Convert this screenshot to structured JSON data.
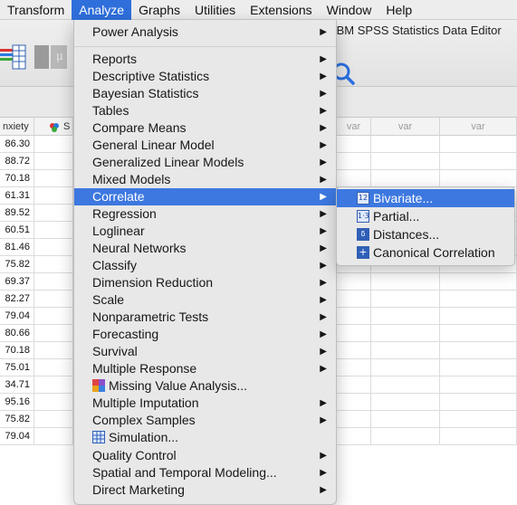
{
  "menubar": {
    "items": [
      {
        "label": "Transform"
      },
      {
        "label": "Analyze"
      },
      {
        "label": "Graphs"
      },
      {
        "label": "Utilities"
      },
      {
        "label": "Extensions"
      },
      {
        "label": "Window"
      },
      {
        "label": "Help"
      }
    ],
    "active": "Analyze"
  },
  "window": {
    "title": "IBM SPSS Statistics Data Editor"
  },
  "grid": {
    "headers": {
      "col1": "nxiety",
      "col2": "S",
      "var_label": "var"
    },
    "values": [
      "86.30",
      "88.72",
      "70.18",
      "61.31",
      "89.52",
      "60.51",
      "81.46",
      "75.82",
      "69.37",
      "82.27",
      "79.04",
      "80.66",
      "70.18",
      "75.01",
      "34.71",
      "95.16",
      "75.82",
      "79.04"
    ]
  },
  "analyze_menu": {
    "items": [
      {
        "label": "Power Analysis",
        "submenu": true
      },
      {
        "label": "Reports",
        "submenu": true
      },
      {
        "label": "Descriptive Statistics",
        "submenu": true
      },
      {
        "label": "Bayesian Statistics",
        "submenu": true
      },
      {
        "label": "Tables",
        "submenu": true
      },
      {
        "label": "Compare Means",
        "submenu": true
      },
      {
        "label": "General Linear Model",
        "submenu": true
      },
      {
        "label": "Generalized Linear Models",
        "submenu": true
      },
      {
        "label": "Mixed Models",
        "submenu": true
      },
      {
        "label": "Correlate",
        "submenu": true,
        "highlighted": true
      },
      {
        "label": "Regression",
        "submenu": true
      },
      {
        "label": "Loglinear",
        "submenu": true
      },
      {
        "label": "Neural Networks",
        "submenu": true
      },
      {
        "label": "Classify",
        "submenu": true
      },
      {
        "label": "Dimension Reduction",
        "submenu": true
      },
      {
        "label": "Scale",
        "submenu": true
      },
      {
        "label": "Nonparametric Tests",
        "submenu": true
      },
      {
        "label": "Forecasting",
        "submenu": true
      },
      {
        "label": "Survival",
        "submenu": true
      },
      {
        "label": "Multiple Response",
        "submenu": true
      },
      {
        "label": "Missing Value Analysis...",
        "submenu": false,
        "icon": "missing-value-icon"
      },
      {
        "label": "Multiple Imputation",
        "submenu": true
      },
      {
        "label": "Complex Samples",
        "submenu": true
      },
      {
        "label": "Simulation...",
        "submenu": false,
        "icon": "simulation-icon"
      },
      {
        "label": "Quality Control",
        "submenu": true
      },
      {
        "label": "Spatial and Temporal Modeling...",
        "submenu": true
      },
      {
        "label": "Direct Marketing",
        "submenu": true
      }
    ]
  },
  "correlate_submenu": {
    "items": [
      {
        "label": "Bivariate...",
        "icon": "bivariate-icon",
        "highlighted": true
      },
      {
        "label": "Partial...",
        "icon": "partial-icon"
      },
      {
        "label": "Distances...",
        "icon": "distances-icon"
      },
      {
        "label": "Canonical Correlation",
        "icon": "canonical-correlation-icon"
      }
    ]
  },
  "colors": {
    "accent": "#3d78e0",
    "menubar_active": "#2f6fdc"
  }
}
